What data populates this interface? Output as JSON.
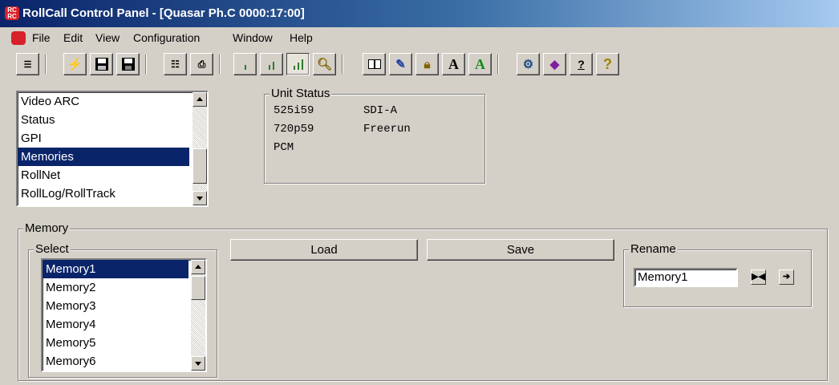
{
  "window": {
    "title": "RollCall Control Panel - [Quasar Ph.C 0000:17:00]"
  },
  "menu": [
    "File",
    "Edit",
    "View",
    "Configuration",
    "Window",
    "Help"
  ],
  "toolbar": {
    "buttons": [
      "connect-icon",
      "flash-icon",
      "open-icon",
      "save-icon",
      "print-setup-icon",
      "print-icon",
      "level1-icon",
      "level2-icon",
      "level3-icon",
      "find-icon",
      "book-icon",
      "edit-icon",
      "lock-icon",
      "font-a-icon",
      "font-a-green-icon",
      "network-icon",
      "help-book-icon",
      "about-icon",
      "whats-this-icon"
    ],
    "font_a_label": "A",
    "help_label": "?"
  },
  "nav_list": {
    "items": [
      "Video ARC",
      "Status",
      "GPI",
      "Memories",
      "RollNet",
      "RollLog/RollTrack"
    ],
    "selected": "Memories"
  },
  "unit_status": {
    "legend": "Unit Status",
    "rows": [
      [
        "525i59",
        "SDI-A"
      ],
      [
        "720p59",
        "Freerun"
      ],
      [
        "PCM",
        ""
      ]
    ]
  },
  "memory": {
    "legend": "Memory",
    "select_legend": "Select",
    "items": [
      "Memory1",
      "Memory2",
      "Memory3",
      "Memory4",
      "Memory5",
      "Memory6"
    ],
    "selected": "Memory1",
    "load_label": "Load",
    "save_label": "Save",
    "rename_legend": "Rename",
    "rename_value": "Memory1"
  },
  "colors": {
    "selection": "#0a246a",
    "face": "#d4d0c8",
    "brand": "#d8202a"
  }
}
